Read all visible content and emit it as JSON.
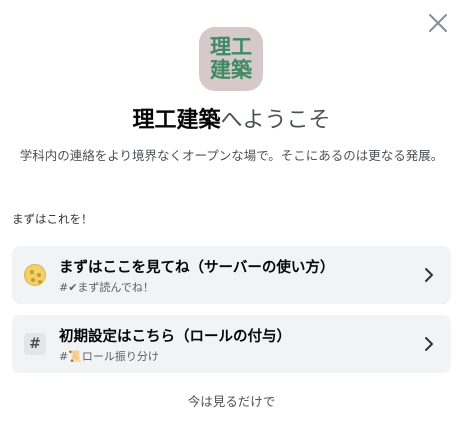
{
  "dialog": {
    "close_icon": "close-icon",
    "server_icon_lines": [
      "理工",
      "建築"
    ],
    "title_name": "理工建築",
    "title_rest": "へようこそ",
    "description": "学科内の連絡をより境界なくオープンな場で。そこにあるのは更なる発展。",
    "section_label": "まずはこれを！",
    "cards": [
      {
        "icon": "cookie-emoji-icon",
        "title": "まずはここを見てね（サーバーの使い方）",
        "subtitle": "#✔まず読んでね！"
      },
      {
        "icon": "hash-icon",
        "title": "初期設定はこちら（ロールの付与）",
        "subtitle": "#📜ロール振り分け"
      }
    ],
    "skip_label": "今は見るだけで"
  },
  "colors": {
    "icon_bg": "#d6c9c9",
    "icon_text": "#3e8a63",
    "card_bg": "#f2f3f5"
  }
}
